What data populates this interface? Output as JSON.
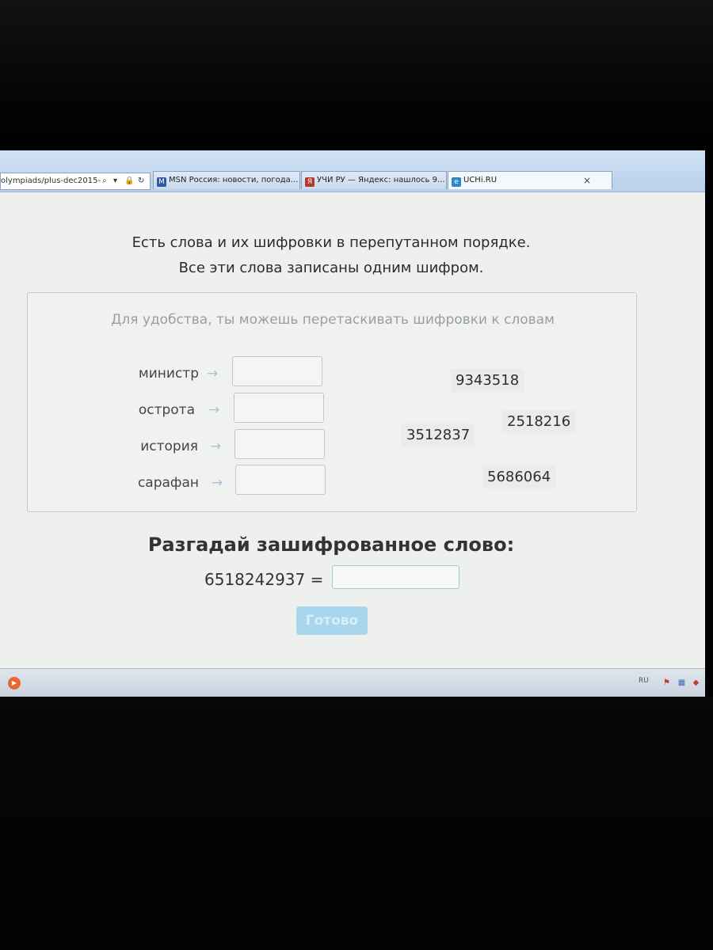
{
  "browser": {
    "address_text": "olympiads/plus-dec2015-",
    "address_icons": [
      "search-icon",
      "dropdown-icon",
      "lock-icon",
      "refresh-icon"
    ],
    "tabs": [
      {
        "label": "MSN Россия: новости, погода...",
        "icon": "msn-icon",
        "active": false
      },
      {
        "label": "УЧИ РУ — Яндекс: нашлось 9...",
        "icon": "yandex-icon",
        "active": false
      },
      {
        "label": "UCHi.RU",
        "icon": "ie-icon",
        "active": true
      }
    ],
    "close_glyph": "×"
  },
  "task": {
    "intro_line1": "Есть слова и их шифровки в перепутанном порядке.",
    "intro_line2": "Все эти слова записаны одним шифром.",
    "hint": "Для удобства, ты можешь перетаскивать шифровки к словам",
    "words": [
      "министр",
      "острота",
      "история",
      "сарафан"
    ],
    "arrow": "→",
    "codes": [
      "9343518",
      "2518216",
      "3512837",
      "5686064"
    ],
    "question": "Разгадай зашифрованное слово:",
    "cipher": "6518242937 =",
    "answer_value": "",
    "done_label": "Готово"
  },
  "taskbar": {
    "lang": "RU"
  },
  "colors": {
    "accent": "#a8d6ec",
    "arrow": "#a9c4d8",
    "page_bg": "#eef0ee"
  }
}
